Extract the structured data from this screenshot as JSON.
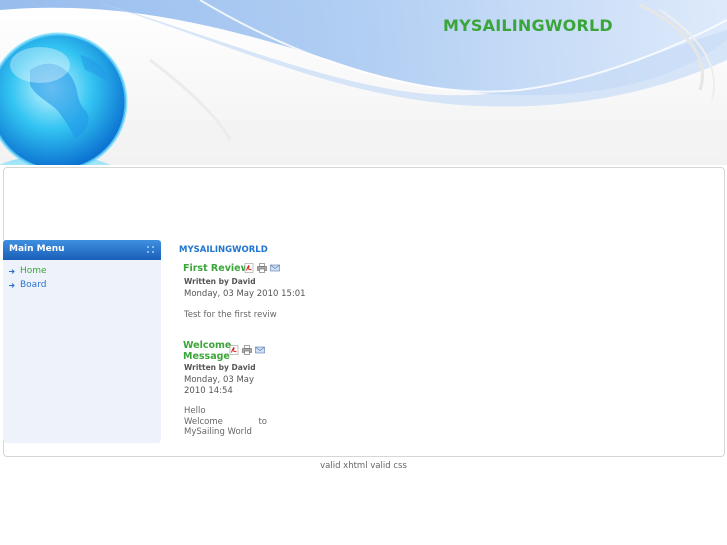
{
  "site": {
    "title": "MYSAILINGWORLD"
  },
  "sidebar": {
    "menu_title": "Main Menu",
    "items": [
      {
        "label": "Home"
      },
      {
        "label": "Board"
      }
    ]
  },
  "content": {
    "section_title": "MYSAILINGWORLD",
    "articles": [
      {
        "title": "First Review",
        "author": "Written by David",
        "date": "Monday, 03 May 2010 15:01",
        "body": "Test for the first reviw"
      },
      {
        "title_line1": "Welcome",
        "title_line2": "Message",
        "author": "Written by David",
        "date_line1": "Monday, 03 May",
        "date_line2": "2010 14:54",
        "body_line1": "Hello",
        "body_line2a": "Welcome",
        "body_line2b": "to",
        "body_line3": "MySailing World"
      }
    ]
  },
  "footer": {
    "xhtml_label": "valid xhtml",
    "css_label": "valid css"
  },
  "colors": {
    "accent_green": "#3aa63a",
    "accent_blue": "#1f75d0",
    "menu_blue": "#1a5fb8"
  },
  "icons": [
    "globe-icon",
    "pdf-icon",
    "print-icon",
    "email-icon",
    "arrow-icon"
  ]
}
